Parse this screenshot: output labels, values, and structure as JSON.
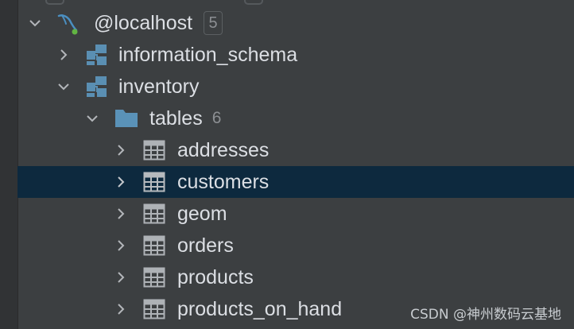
{
  "tree": {
    "host": {
      "label": "@localhost",
      "count": "5",
      "icon": "mysql-dolphin-icon"
    },
    "schemas": [
      {
        "label": "information_schema",
        "expanded": false,
        "icon": "schema-icon"
      },
      {
        "label": "inventory",
        "expanded": true,
        "icon": "schema-icon"
      }
    ],
    "tables_folder": {
      "label": "tables",
      "count": "6",
      "icon": "folder-icon"
    },
    "tables": [
      {
        "label": "addresses",
        "icon": "table-icon",
        "selected": false
      },
      {
        "label": "customers",
        "icon": "table-icon",
        "selected": true
      },
      {
        "label": "geom",
        "icon": "table-icon",
        "selected": false
      },
      {
        "label": "orders",
        "icon": "table-icon",
        "selected": false
      },
      {
        "label": "products",
        "icon": "table-icon",
        "selected": false
      },
      {
        "label": "products_on_hand",
        "icon": "table-icon",
        "selected": false
      }
    ]
  },
  "watermark": "CSDN @神州数码云基地",
  "colors": {
    "background": "#3c3f41",
    "selection": "#0d293e",
    "text": "#dcdfe4",
    "count": "#8c8f93",
    "schema_icon": "#5a8fb3",
    "folder_icon": "#5a92b8"
  }
}
